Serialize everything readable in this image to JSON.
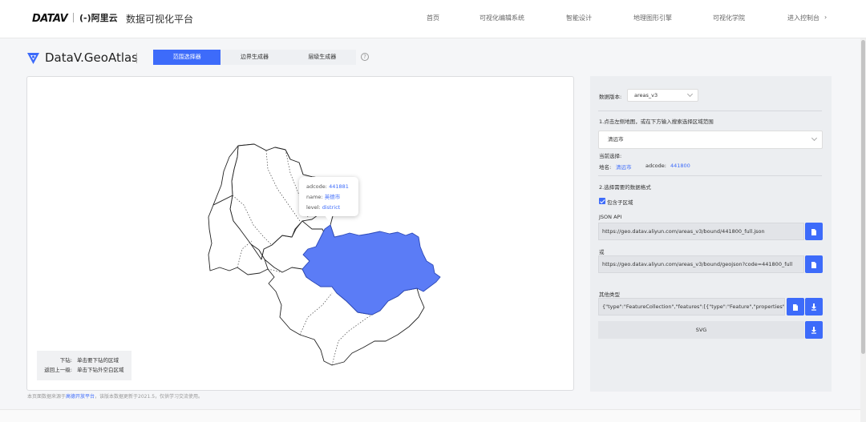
{
  "header": {
    "brand_datav": "DATAV",
    "brand_ali": "(-)阿里云",
    "brand_title": "数据可视化平台",
    "nav": [
      {
        "label": "首页"
      },
      {
        "label": "可视化编辑系统"
      },
      {
        "label": "智能设计"
      },
      {
        "label": "地理图形引擎"
      },
      {
        "label": "可视化学院"
      },
      {
        "label": "进入控制台"
      }
    ],
    "nav_arrow": "›"
  },
  "product": {
    "name": "DataV.GeoAtlas",
    "tabs": [
      {
        "label": "范围选择器",
        "active": true
      },
      {
        "label": "边界生成器",
        "active": false
      },
      {
        "label": "层级生成器",
        "active": false
      }
    ],
    "help": "?"
  },
  "map": {
    "selected_color": "#5b7cf6",
    "tooltip": {
      "adcode_key": "adcode:",
      "adcode_val": "441881",
      "name_key": "name:",
      "name_val": "英德市",
      "level_key": "level:",
      "level_val": "district"
    },
    "legend": [
      {
        "key": "下钻:",
        "val": "单击要下钻的区域"
      },
      {
        "key": "返回上一级:",
        "val": "单击下钻外空白区域"
      }
    ]
  },
  "footnote": {
    "pre": "本页面数据来源于",
    "link": "高德开放平台",
    "post": "，该版本数据更新于2021.5，仅供学习交流使用。"
  },
  "side": {
    "version_label": "数据版本:",
    "version_value": "areas_v3",
    "step1": "1.点击左侧地图，或在下方输入搜索选择区域范围",
    "region_value": "清远市",
    "current_label": "当前选择:",
    "place_label": "地名:",
    "place_value": "清远市",
    "adcode_label": "adcode:",
    "adcode_value": "441800",
    "step2": "2.选择需要的数据格式",
    "include_children": "包含子区域",
    "json_api_label": "JSON API",
    "json_api_url": "https://geo.datav.aliyun.com/areas_v3/bound/441800_full.json",
    "or_label": "或",
    "geojson_url": "https://geo.datav.aliyun.com/areas_v3/bound/geojson?code=441800_full",
    "other_label": "其他类型",
    "geojson_preview": "{\"type\":\"FeatureCollection\",\"features\":[{\"type\":\"Feature\",\"properties\":{\"a",
    "svg_label": "SVG"
  }
}
